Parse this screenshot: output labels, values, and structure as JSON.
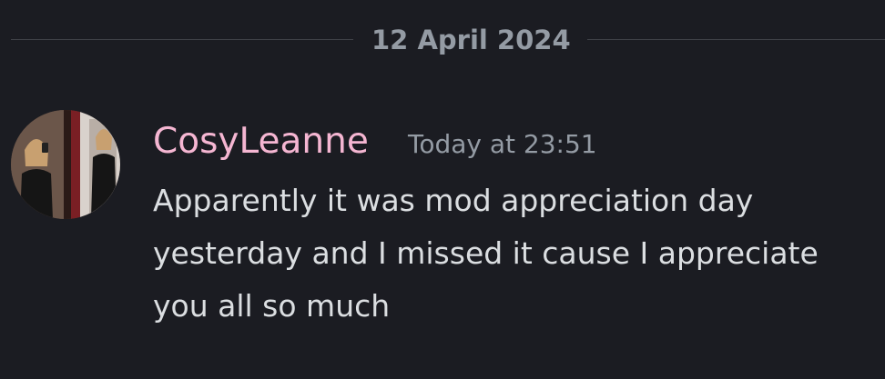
{
  "date_divider": {
    "label": "12 April 2024"
  },
  "message": {
    "author": "CosyLeanne",
    "author_color": "#f5b6d2",
    "timestamp": "Today at 23:51",
    "text": "Apparently it was mod appreciation day yesterday and I missed it cause I appreciate you all so much"
  },
  "theme": {
    "background": "#1b1c22",
    "muted_text": "#949ba4",
    "body_text": "#dbdee1"
  }
}
